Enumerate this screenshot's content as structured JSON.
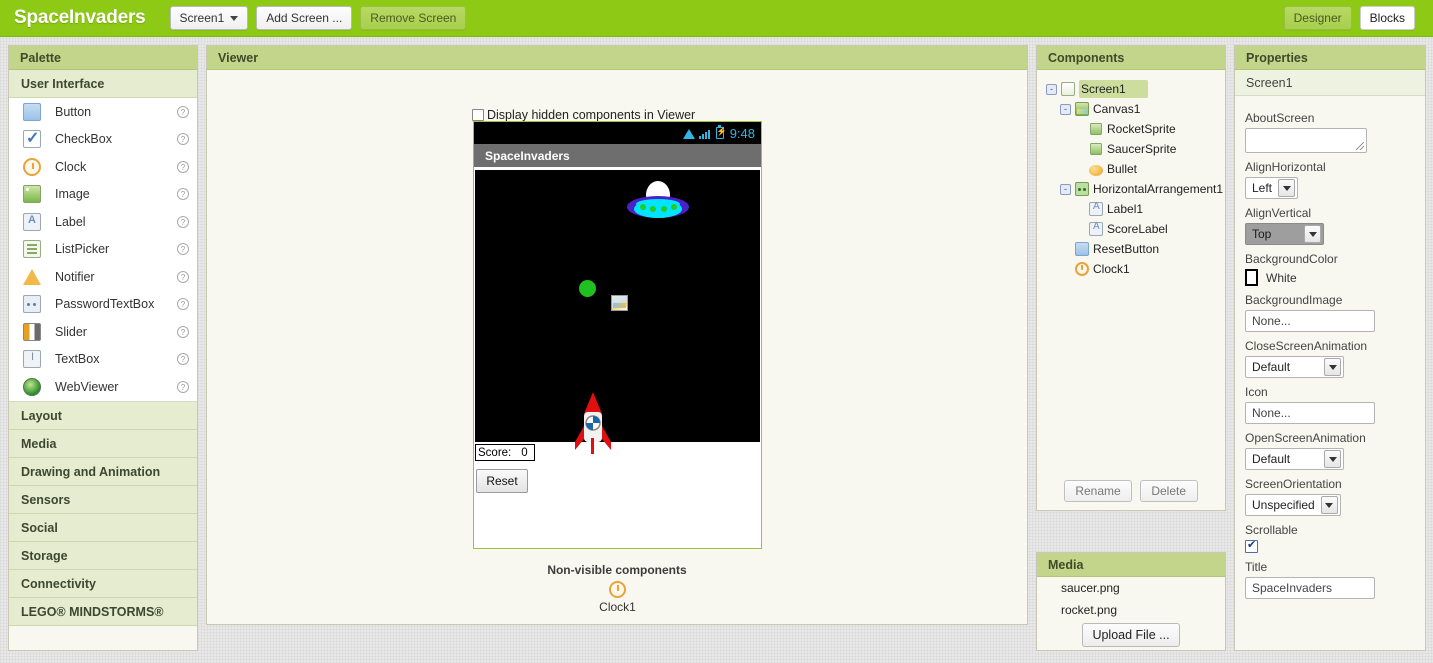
{
  "topbar": {
    "app_title": "SpaceInvaders",
    "screen_selector": "Screen1",
    "add_screen": "Add Screen ...",
    "remove_screen": "Remove Screen",
    "designer": "Designer",
    "blocks": "Blocks"
  },
  "palette": {
    "header": "Palette",
    "categories": [
      {
        "name": "User Interface",
        "open": true,
        "items": [
          {
            "label": "Button",
            "icon": "button-icon"
          },
          {
            "label": "CheckBox",
            "icon": "checkbox-icon"
          },
          {
            "label": "Clock",
            "icon": "clock-icon"
          },
          {
            "label": "Image",
            "icon": "image-icon"
          },
          {
            "label": "Label",
            "icon": "label-icon"
          },
          {
            "label": "ListPicker",
            "icon": "listpicker-icon"
          },
          {
            "label": "Notifier",
            "icon": "notifier-icon"
          },
          {
            "label": "PasswordTextBox",
            "icon": "passwordtextbox-icon"
          },
          {
            "label": "Slider",
            "icon": "slider-icon"
          },
          {
            "label": "TextBox",
            "icon": "textbox-icon"
          },
          {
            "label": "WebViewer",
            "icon": "webviewer-icon"
          }
        ]
      },
      {
        "name": "Layout"
      },
      {
        "name": "Media"
      },
      {
        "name": "Drawing and Animation"
      },
      {
        "name": "Sensors"
      },
      {
        "name": "Social"
      },
      {
        "name": "Storage"
      },
      {
        "name": "Connectivity"
      },
      {
        "name": "LEGO® MINDSTORMS®"
      }
    ]
  },
  "viewer": {
    "header": "Viewer",
    "hidden_components_label": "Display hidden components in Viewer",
    "hidden_components_checked": false,
    "phone": {
      "status_time": "9:48",
      "title": "SpaceInvaders",
      "score_label": "Score:",
      "score_value": "0",
      "reset_button": "Reset"
    },
    "nonvisible_title": "Non-visible components",
    "nonvisible_items": [
      {
        "label": "Clock1",
        "icon": "clock-icon"
      }
    ]
  },
  "components": {
    "header": "Components",
    "tree": [
      {
        "label": "Screen1",
        "depth": 0,
        "toggle": "-",
        "icon": "screen-icon",
        "selected": true
      },
      {
        "label": "Canvas1",
        "depth": 1,
        "toggle": "-",
        "icon": "canvas-icon",
        "selected": false
      },
      {
        "label": "RocketSprite",
        "depth": 2,
        "toggle": "",
        "icon": "sprite-icon",
        "selected": false
      },
      {
        "label": "SaucerSprite",
        "depth": 2,
        "toggle": "",
        "icon": "sprite-icon",
        "selected": false
      },
      {
        "label": "Bullet",
        "depth": 2,
        "toggle": "",
        "icon": "ball-icon",
        "selected": false
      },
      {
        "label": "HorizontalArrangement1",
        "depth": 1,
        "toggle": "-",
        "icon": "harr-icon",
        "selected": false
      },
      {
        "label": "Label1",
        "depth": 2,
        "toggle": "",
        "icon": "label-icon",
        "selected": false
      },
      {
        "label": "ScoreLabel",
        "depth": 2,
        "toggle": "",
        "icon": "label-icon",
        "selected": false
      },
      {
        "label": "ResetButton",
        "depth": 1,
        "toggle": "",
        "icon": "button-icon",
        "selected": false
      },
      {
        "label": "Clock1",
        "depth": 1,
        "toggle": "",
        "icon": "clock-icon",
        "selected": false
      }
    ],
    "rename_button": "Rename",
    "delete_button": "Delete"
  },
  "media": {
    "header": "Media",
    "files": [
      "saucer.png",
      "rocket.png"
    ],
    "upload_button": "Upload File ..."
  },
  "properties": {
    "header": "Properties",
    "component_name": "Screen1",
    "items": [
      {
        "label": "AboutScreen",
        "type": "textarea",
        "value": ""
      },
      {
        "label": "AlignHorizontal",
        "type": "select",
        "value": "Left"
      },
      {
        "label": "AlignVertical",
        "type": "select",
        "value": "Top",
        "highlight": true
      },
      {
        "label": "BackgroundColor",
        "type": "color",
        "value": "White"
      },
      {
        "label": "BackgroundImage",
        "type": "input",
        "value": "None..."
      },
      {
        "label": "CloseScreenAnimation",
        "type": "select",
        "value": "Default"
      },
      {
        "label": "Icon",
        "type": "input",
        "value": "None..."
      },
      {
        "label": "OpenScreenAnimation",
        "type": "select",
        "value": "Default"
      },
      {
        "label": "ScreenOrientation",
        "type": "select",
        "value": "Unspecified"
      },
      {
        "label": "Scrollable",
        "type": "checkbox",
        "value": "checked"
      },
      {
        "label": "Title",
        "type": "input",
        "value": "SpaceInvaders"
      }
    ]
  },
  "colors": {
    "brand_green": "#8ec916",
    "panel_header": "#c3d58a",
    "panel_bg": "#f8f8f0",
    "status_icon": "#33b5e5",
    "bullet_green": "#20c020"
  }
}
